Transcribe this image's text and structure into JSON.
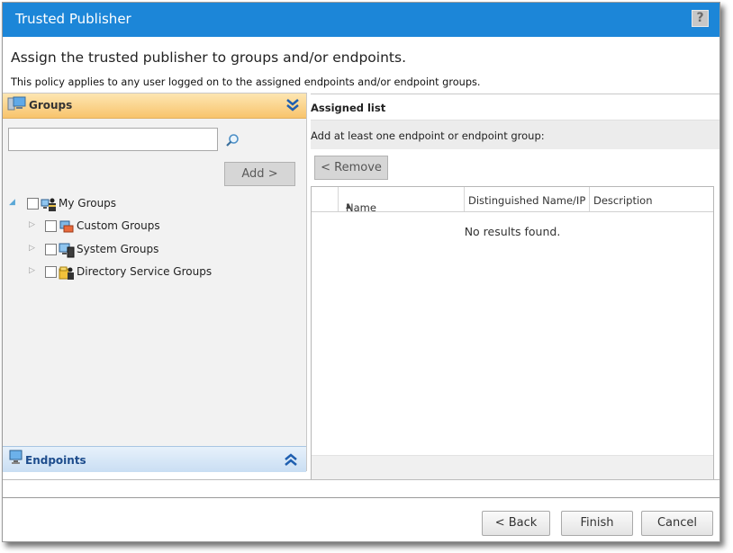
{
  "window": {
    "title": "Trusted Publisher",
    "help_label": "?"
  },
  "heading": "Assign the trusted publisher to groups and/or endpoints.",
  "subtext": "This policy applies to any user logged on to the assigned endpoints and/or endpoint groups.",
  "groups_panel": {
    "header": "Groups",
    "search_value": "",
    "add_label": "Add >",
    "tree": [
      {
        "label": "My Groups",
        "expanded": true,
        "icon": "my-groups-icon"
      },
      {
        "label": "Custom Groups",
        "expanded": false,
        "icon": "custom-groups-icon"
      },
      {
        "label": "System Groups",
        "expanded": false,
        "icon": "system-groups-icon"
      },
      {
        "label": "Directory Service Groups",
        "expanded": false,
        "icon": "directory-service-groups-icon"
      }
    ]
  },
  "endpoints_panel": {
    "header": "Endpoints"
  },
  "assigned": {
    "title": "Assigned list",
    "instruction": "Add at least one endpoint or endpoint group:",
    "remove_label": "< Remove",
    "columns": [
      "Name",
      "Distinguished Name/IP",
      "Description"
    ],
    "empty_text": "No results found."
  },
  "footer": {
    "back": "< Back",
    "finish": "Finish",
    "cancel": "Cancel"
  },
  "colors": {
    "titlebar": "#1c86d8",
    "groups_header": "#f8c46c",
    "endpoints_header": "#c9def3"
  }
}
